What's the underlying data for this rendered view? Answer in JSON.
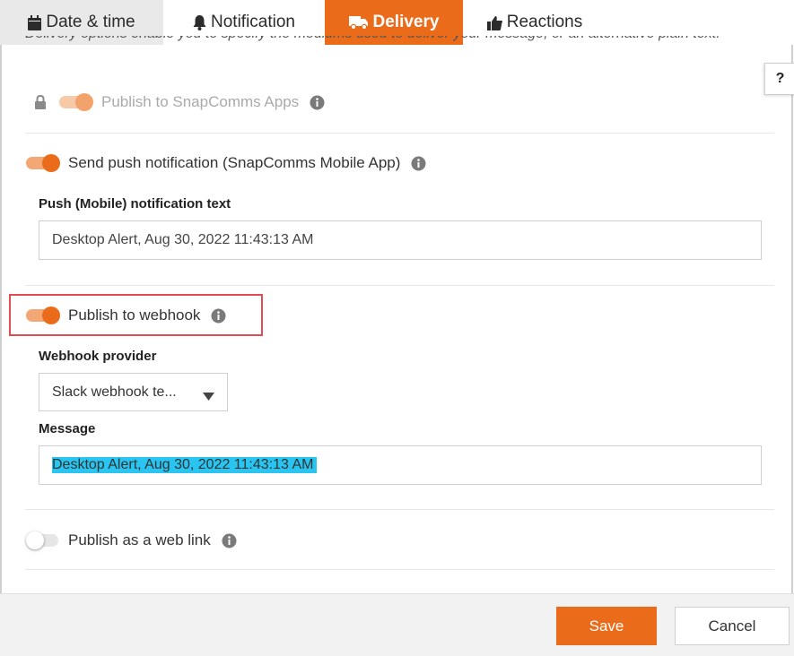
{
  "tabs": [
    {
      "label": "Date & time",
      "icon": "calendar-icon"
    },
    {
      "label": "Notification",
      "icon": "bell-icon"
    },
    {
      "label": "Delivery",
      "icon": "truck-icon",
      "active": true
    },
    {
      "label": "Reactions",
      "icon": "thumbs-up-icon"
    }
  ],
  "intro_text": "Delivery options enable you to specify the mediums used to deliver your message, or an alternative plain text.",
  "help_label": "?",
  "options": {
    "snapcomms_apps": {
      "label": "Publish to SnapComms Apps",
      "enabled": true,
      "locked": true
    },
    "push": {
      "label": "Send push notification (SnapComms Mobile App)",
      "enabled": true
    },
    "webhook": {
      "label": "Publish to webhook",
      "enabled": true
    },
    "weblink": {
      "label": "Publish as a web link",
      "enabled": false
    }
  },
  "push_section": {
    "field_label": "Push (Mobile) notification text",
    "value": "Desktop Alert, Aug 30, 2022 11:43:13 AM"
  },
  "webhook_section": {
    "provider_label": "Webhook provider",
    "provider_value": "Slack webhook te...",
    "message_label": "Message",
    "message_value": "Desktop Alert, Aug 30, 2022 11:43:13 AM"
  },
  "footer": {
    "save_label": "Save",
    "cancel_label": "Cancel"
  },
  "colors": {
    "accent": "#ea6c1b",
    "highlight": "#e14d52",
    "selection": "#29c4f0"
  }
}
